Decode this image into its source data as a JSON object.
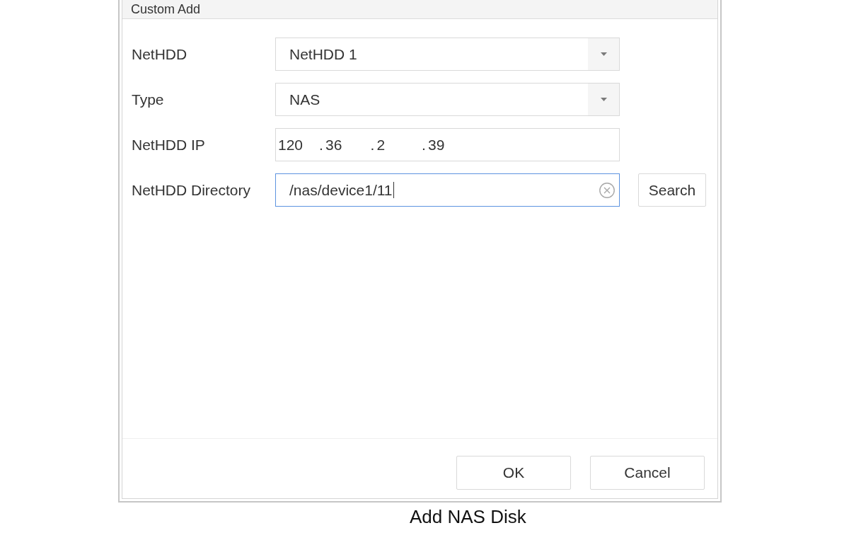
{
  "dialog": {
    "title": "Custom Add",
    "fields": [
      {
        "label": "NetHDD",
        "kind": "select",
        "value": "NetHDD 1",
        "focused": false
      },
      {
        "label": "Type",
        "kind": "select",
        "value": "NAS",
        "focused": false
      },
      {
        "label": "NetHDD IP",
        "kind": "ip",
        "segments": [
          "120",
          "36",
          "2",
          "39"
        ],
        "separator": ".",
        "focused": false
      },
      {
        "label": "NetHDD Directory",
        "kind": "text",
        "value": "/nas/device1/11",
        "focused": true,
        "button": "Search"
      }
    ],
    "buttons": [
      "OK",
      "Cancel"
    ]
  },
  "caption": "Add NAS Disk"
}
